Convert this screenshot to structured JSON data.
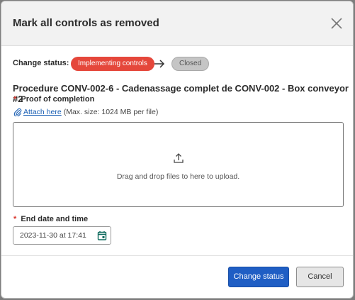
{
  "dialog": {
    "title": "Mark all controls as removed",
    "close_icon": "close-icon"
  },
  "status": {
    "label": "Change status:",
    "from": "Implementing controls",
    "to": "Closed",
    "from_color": "#e5473b",
    "to_color": "#c5c5c5",
    "arrow_icon": "arrow-right-icon"
  },
  "procedure": {
    "title": "Procedure CONV-002-6 - Cadenassage complet de CONV-002 - Box conveyor #2"
  },
  "proof": {
    "required_mark": "*",
    "label": "Proof of completion",
    "attach_icon": "paperclip-icon",
    "attach_link": "Attach here",
    "max_size": "(Max. size: 1024 MB per file)",
    "upload_icon": "upload-icon",
    "drop_text": "Drag and drop files to here to upload."
  },
  "end_date": {
    "required_mark": "*",
    "label": "End date and time",
    "value": "2023-11-30 at 17:41",
    "calendar_icon": "calendar-icon"
  },
  "buttons": {
    "primary": "Change status",
    "secondary": "Cancel",
    "primary_color": "#1f5ec4"
  }
}
